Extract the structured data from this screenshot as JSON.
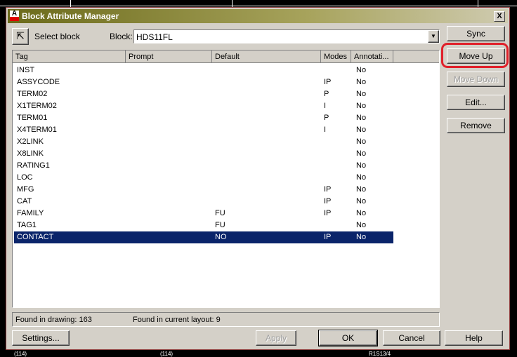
{
  "dialog": {
    "title": "Block Attribute Manager",
    "close": "X"
  },
  "select_block": {
    "label": "Select block"
  },
  "block": {
    "label": "Block:",
    "value": "HDS11FL"
  },
  "columns": [
    "Tag",
    "Prompt",
    "Default",
    "Modes",
    "Annotati..."
  ],
  "rows": [
    {
      "tag": "INST",
      "prompt": "",
      "default": "",
      "modes": "",
      "annot": "No"
    },
    {
      "tag": "ASSYCODE",
      "prompt": "",
      "default": "",
      "modes": "IP",
      "annot": "No"
    },
    {
      "tag": "TERM02",
      "prompt": "",
      "default": "",
      "modes": "P",
      "annot": "No"
    },
    {
      "tag": "X1TERM02",
      "prompt": "",
      "default": "",
      "modes": "I",
      "annot": "No"
    },
    {
      "tag": "TERM01",
      "prompt": "",
      "default": "",
      "modes": "P",
      "annot": "No"
    },
    {
      "tag": "X4TERM01",
      "prompt": "",
      "default": "",
      "modes": "I",
      "annot": "No"
    },
    {
      "tag": "X2LINK",
      "prompt": "",
      "default": "",
      "modes": "",
      "annot": "No"
    },
    {
      "tag": "X8LINK",
      "prompt": "",
      "default": "",
      "modes": "",
      "annot": "No"
    },
    {
      "tag": "RATING1",
      "prompt": "",
      "default": "",
      "modes": "",
      "annot": "No"
    },
    {
      "tag": "LOC",
      "prompt": "",
      "default": "",
      "modes": "",
      "annot": "No"
    },
    {
      "tag": "MFG",
      "prompt": "",
      "default": "",
      "modes": "IP",
      "annot": "No"
    },
    {
      "tag": "CAT",
      "prompt": "",
      "default": "",
      "modes": "IP",
      "annot": "No"
    },
    {
      "tag": "FAMILY",
      "prompt": "",
      "default": "FU",
      "modes": "IP",
      "annot": "No"
    },
    {
      "tag": "TAG1",
      "prompt": "",
      "default": "FU",
      "modes": "",
      "annot": "No"
    },
    {
      "tag": "CONTACT",
      "prompt": "",
      "default": "NO",
      "modes": "IP",
      "annot": "No"
    }
  ],
  "selected_row": 14,
  "side_buttons": {
    "sync": "Sync",
    "move_up": "Move Up",
    "move_down": "Move Down",
    "edit": "Edit...",
    "remove": "Remove"
  },
  "status": {
    "drawing": "Found in drawing: 163",
    "layout": "Found in current layout: 9"
  },
  "bottom_buttons": {
    "settings": "Settings...",
    "apply": "Apply",
    "ok": "OK",
    "cancel": "Cancel",
    "help": "Help"
  },
  "background": {
    "label1": "(114)",
    "label2": "(114)",
    "label3": "R1S13/4"
  }
}
